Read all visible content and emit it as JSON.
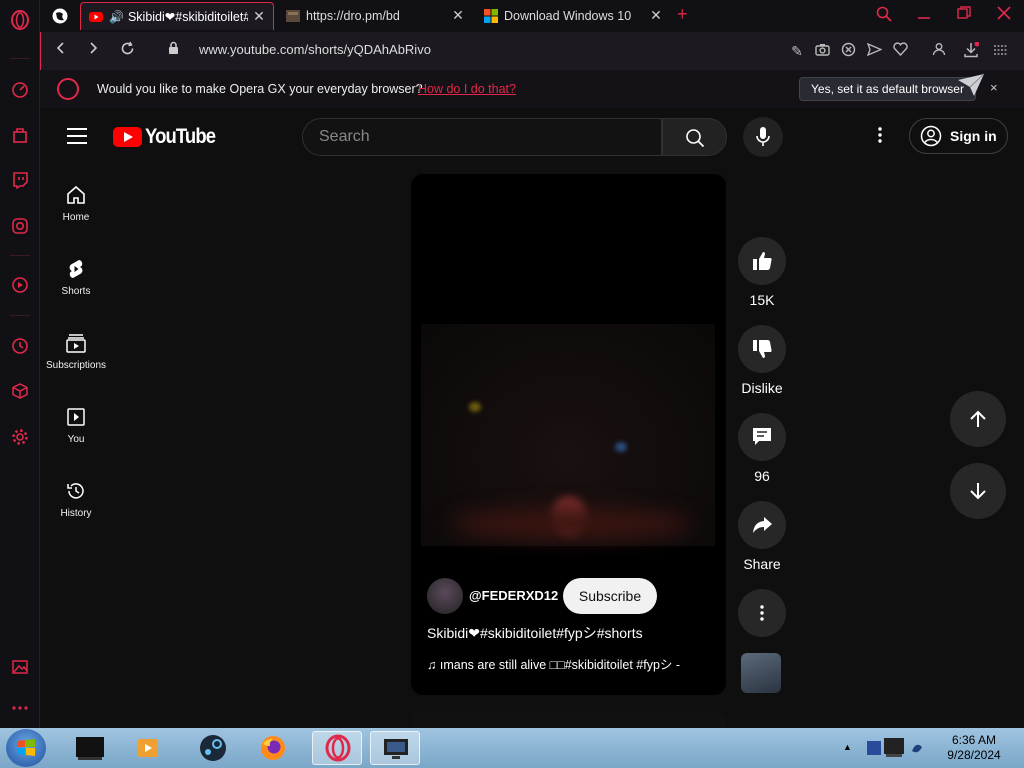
{
  "browser": {
    "tabs": [
      {
        "title": "Skibidi❤#skibiditoilet#f",
        "active": true
      },
      {
        "title": "https://dro.pm/bd",
        "active": false
      },
      {
        "title": "Download Windows 10",
        "active": false
      }
    ],
    "url": "www.youtube.com/shorts/yQDAhAbRivo",
    "accent_color": "#e0294a"
  },
  "banner": {
    "message": "Would you like to make Opera GX your everyday browser?",
    "link": "How do I do that?",
    "confirm": "Yes, set it as default browser",
    "close": "×"
  },
  "youtube": {
    "logo_text": "YouTube",
    "search_placeholder": "Search",
    "sign_in": "Sign in",
    "guide": [
      {
        "label": "Home",
        "icon": "home-icon"
      },
      {
        "label": "Shorts",
        "icon": "shorts-icon"
      },
      {
        "label": "Subscriptions",
        "icon": "subscriptions-icon"
      },
      {
        "label": "You",
        "icon": "you-icon"
      },
      {
        "label": "History",
        "icon": "history-icon"
      }
    ],
    "short": {
      "channel": "@FEDERXD12",
      "subscribe": "Subscribe",
      "title": "Skibidi❤#skibiditoilet#fypシ#shorts",
      "music": "ımans are still alive □□#skibiditoilet #fypシ -"
    },
    "actions": {
      "likes": "15K",
      "dislike": "Dislike",
      "comments": "96",
      "share": "Share"
    }
  },
  "taskbar": {
    "time": "6:36 AM",
    "date": "9/28/2024"
  }
}
